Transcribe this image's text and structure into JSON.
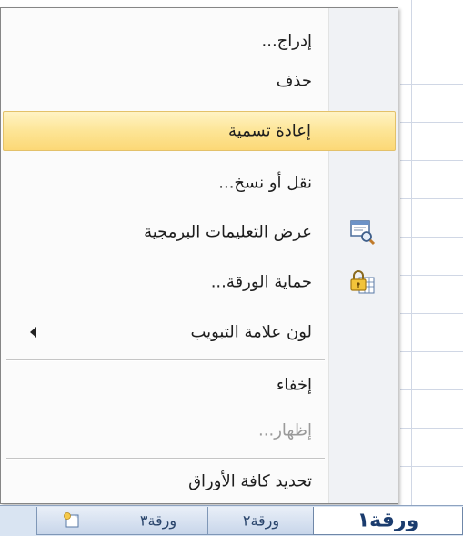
{
  "menu": {
    "items": [
      {
        "label": "إدراج...",
        "icon": "",
        "disabled": false
      },
      {
        "label": "حذف",
        "icon": "",
        "disabled": false
      },
      {
        "label": "إعادة تسمية",
        "icon": "",
        "disabled": false,
        "highlighted": true
      },
      {
        "label": "نقل أو نسخ...",
        "icon": "",
        "disabled": false
      },
      {
        "label": "عرض التعليمات البرمجية",
        "icon": "view-code-icon",
        "disabled": false
      },
      {
        "label": "حماية الورقة...",
        "icon": "protect-sheet-lock-icon",
        "disabled": false
      },
      {
        "label": "لون علامة التبويب",
        "icon": "",
        "disabled": false,
        "submenu": true
      },
      {
        "label": "إخفاء",
        "icon": "",
        "disabled": false
      },
      {
        "label": "إظهار...",
        "icon": "",
        "disabled": true
      },
      {
        "label": "تحديد كافة الأوراق",
        "icon": "",
        "disabled": false
      }
    ]
  },
  "tabs": {
    "sheet1": "ورقة١",
    "sheet2": "ورقة٢",
    "sheet3": "ورقة٣",
    "insert_sheet_icon": "insert-worksheet-icon"
  },
  "colors": {
    "highlight": "#fde596",
    "menu_bg": "#fbfbfb",
    "tab_bar": "#d9e4f2"
  }
}
